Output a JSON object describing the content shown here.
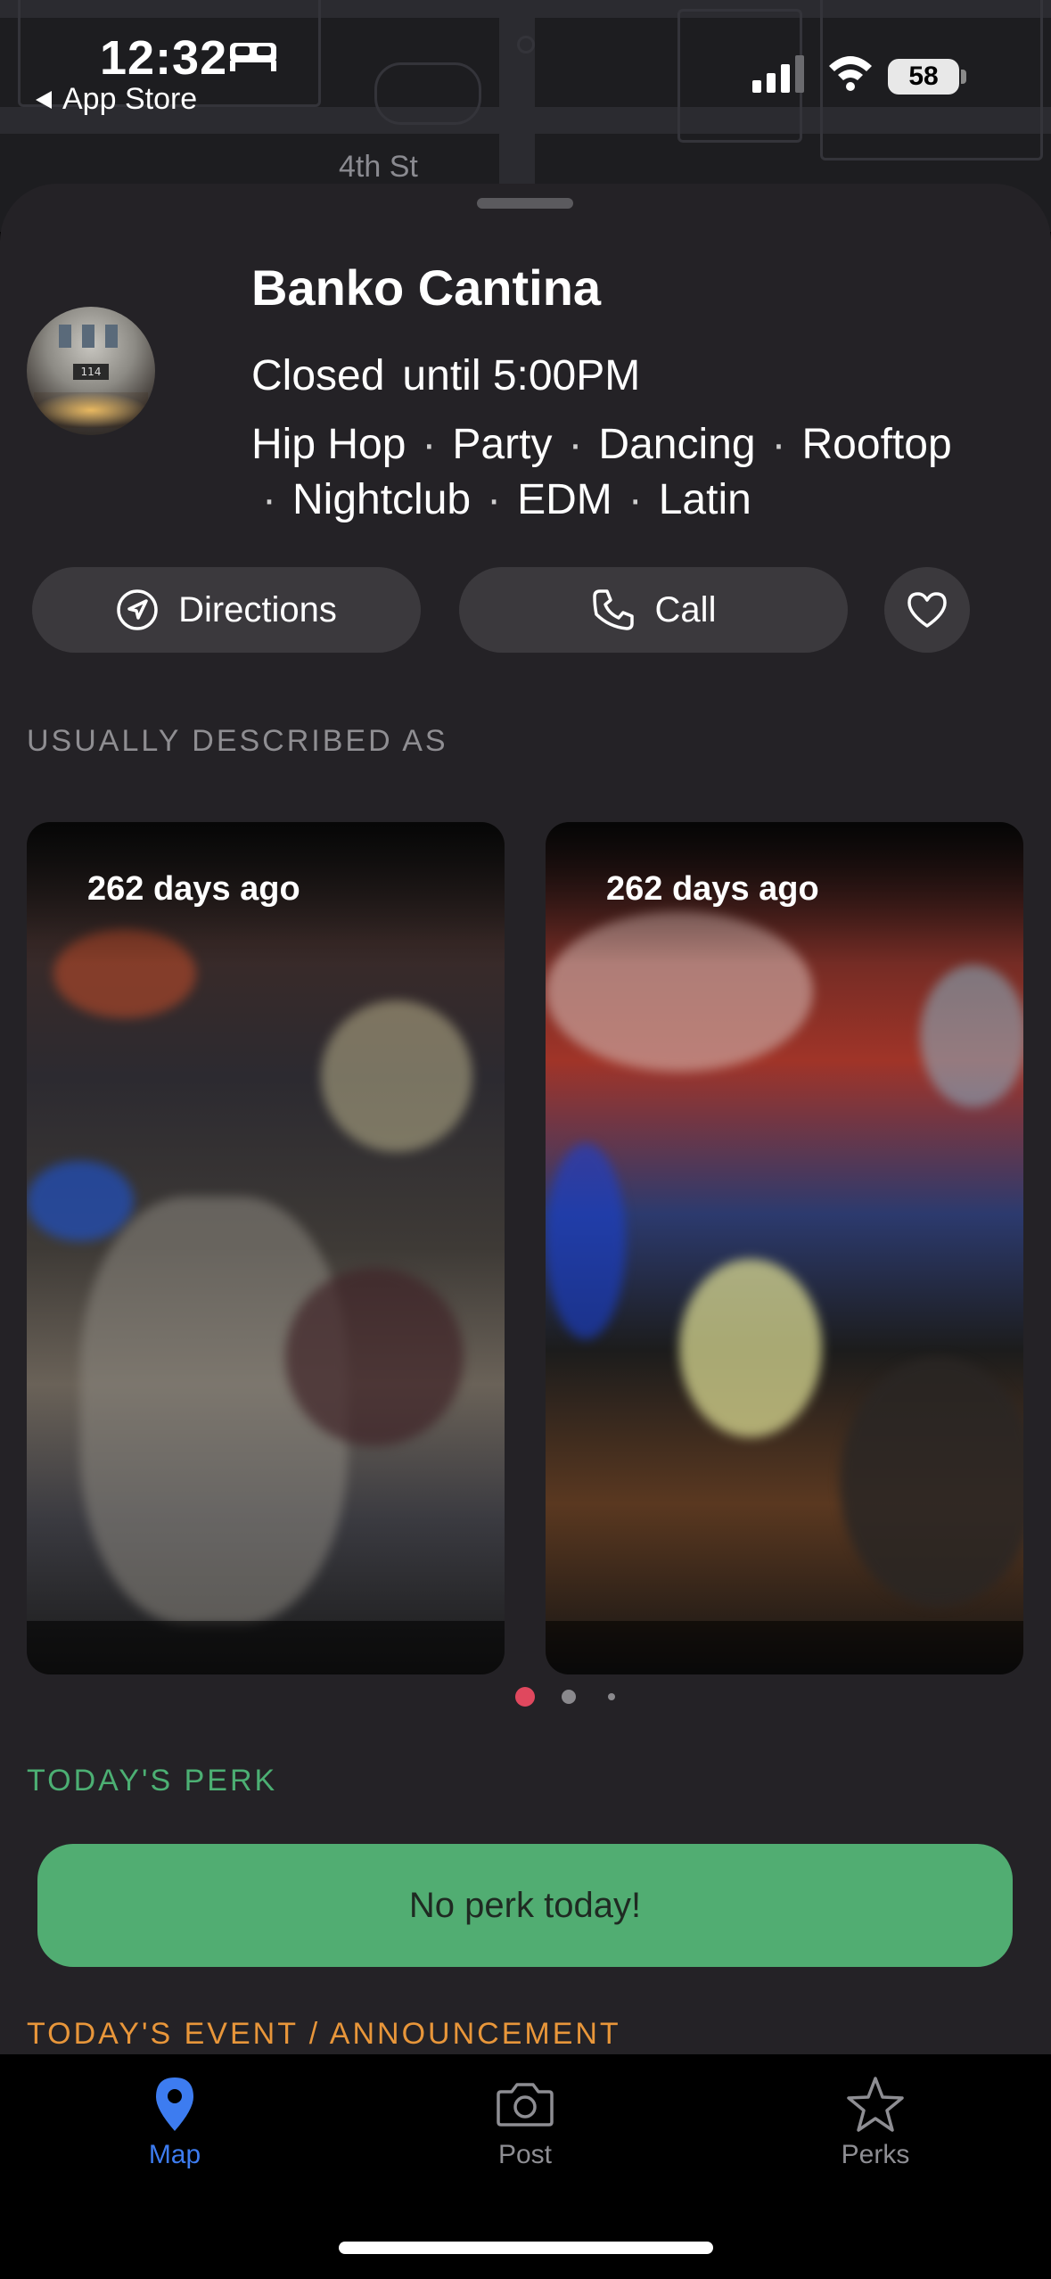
{
  "status_bar": {
    "time": "12:32",
    "back_label": "App Store",
    "battery": "58"
  },
  "map": {
    "street_label": "4th St"
  },
  "venue": {
    "name": "Banko Cantina",
    "status": "Closed",
    "until": "until 5:00PM",
    "avatar_sign": "114",
    "tags": [
      "Hip Hop",
      "Party",
      "Dancing",
      "Rooftop",
      "Nightclub",
      "EDM",
      "Latin"
    ]
  },
  "actions": {
    "directions_label": "Directions",
    "call_label": "Call",
    "favorite_icon": "heart-icon"
  },
  "sections": {
    "described_label": "USUALLY DESCRIBED AS",
    "perk_label": "TODAY'S PERK",
    "event_label": "TODAY'S EVENT / ANNOUNCEMENT"
  },
  "media_cards": [
    {
      "age": "262 days ago"
    },
    {
      "age": "262 days ago"
    }
  ],
  "carousel": {
    "page_count": 3,
    "active_index": 0,
    "active_color": "#e0485e"
  },
  "perk": {
    "text": "No perk today!",
    "color": "#51ad72"
  },
  "tabbar": {
    "tabs": [
      {
        "label": "Map",
        "icon": "map-pin-icon",
        "active": true
      },
      {
        "label": "Post",
        "icon": "camera-icon",
        "active": false
      },
      {
        "label": "Perks",
        "icon": "star-icon",
        "active": false
      }
    ],
    "active_color": "#3d7cf0"
  }
}
